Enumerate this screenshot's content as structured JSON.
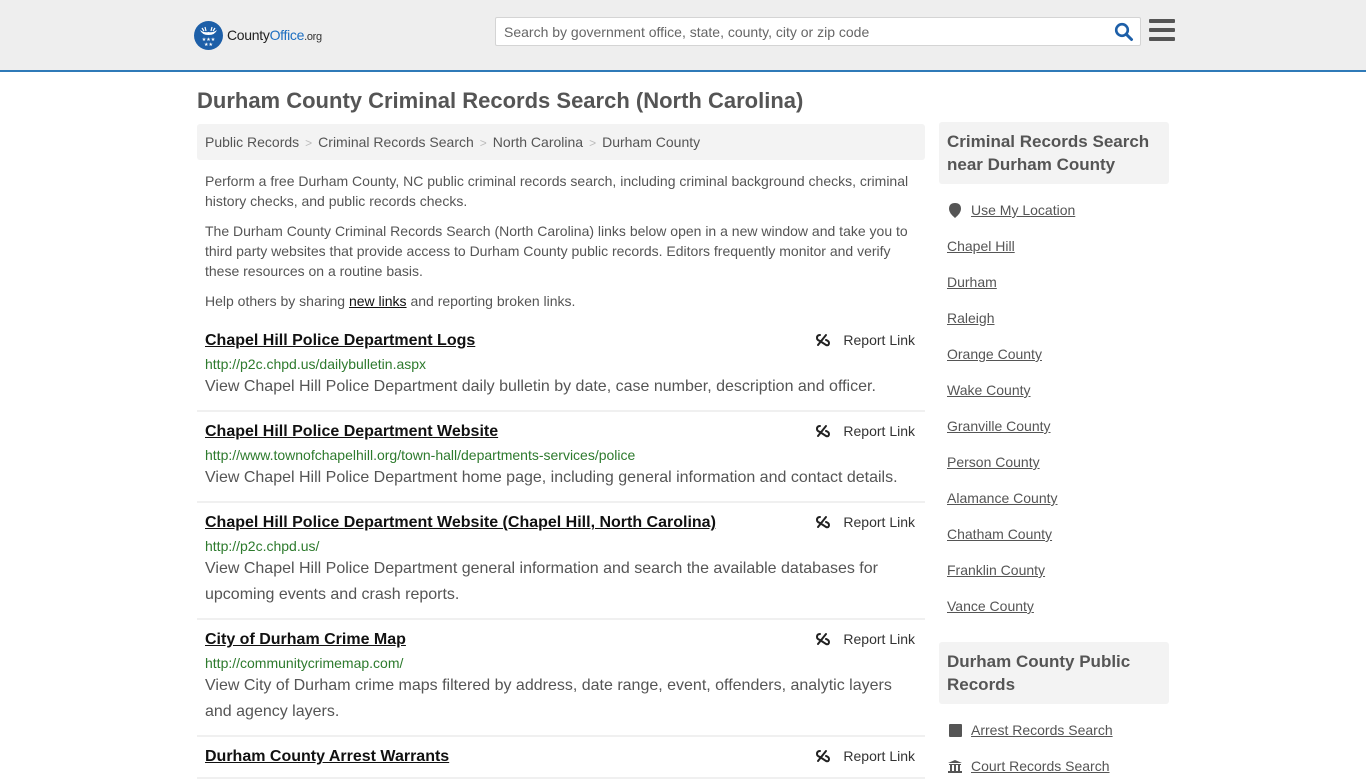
{
  "header": {
    "logo": {
      "name": "County",
      "name_accent": "Office",
      "tld": ".org"
    },
    "search": {
      "placeholder": "Search by government office, state, county, city or zip code",
      "value": ""
    },
    "colors": {
      "accent": "#2f7ab8",
      "logo_blue": "#1d5fa8"
    }
  },
  "page": {
    "title": "Durham County Criminal Records Search (North Carolina)"
  },
  "breadcrumb": [
    {
      "label": "Public Records"
    },
    {
      "label": "Criminal Records Search"
    },
    {
      "label": "North Carolina"
    },
    {
      "label": "Durham County"
    }
  ],
  "intro": {
    "p1": "Perform a free Durham County, NC public criminal records search, including criminal background checks, criminal history checks, and public records checks.",
    "p2": "The Durham County Criminal Records Search (North Carolina) links below open in a new window and take you to third party websites that provide access to Durham County public records. Editors frequently monitor and verify these resources on a routine basis.",
    "p3_before": "Help others by sharing ",
    "p3_link": "new links",
    "p3_after": " and reporting broken links."
  },
  "results": [
    {
      "title": "Chapel Hill Police Department Logs",
      "url": "http://p2c.chpd.us/dailybulletin.aspx",
      "description": "View Chapel Hill Police Department daily bulletin by date, case number, description and officer.",
      "report_label": "Report Link"
    },
    {
      "title": "Chapel Hill Police Department Website",
      "url": "http://www.townofchapelhill.org/town-hall/departments-services/police",
      "description": "View Chapel Hill Police Department home page, including general information and contact details.",
      "report_label": "Report Link"
    },
    {
      "title": "Chapel Hill Police Department Website (Chapel Hill, North Carolina)",
      "url": "http://p2c.chpd.us/",
      "description": "View Chapel Hill Police Department general information and search the available databases for upcoming events and crash reports.",
      "report_label": "Report Link"
    },
    {
      "title": "City of Durham Crime Map",
      "url": "http://communitycrimemap.com/",
      "description": "View City of Durham crime maps filtered by address, date range, event, offenders, analytic layers and agency layers.",
      "report_label": "Report Link"
    },
    {
      "title": "Durham County Arrest Warrants",
      "url": "",
      "description": "",
      "report_label": "Report Link"
    }
  ],
  "sidebar": {
    "nearby": {
      "heading": "Criminal Records Search near Durham County",
      "use_location": "Use My Location",
      "items": [
        "Chapel Hill",
        "Durham",
        "Raleigh",
        "Orange County",
        "Wake County",
        "Granville County",
        "Person County",
        "Alamance County",
        "Chatham County",
        "Franklin County",
        "Vance County"
      ]
    },
    "public_records": {
      "heading": "Durham County Public Records",
      "items": [
        {
          "label": "Arrest Records Search",
          "icon": "square-icon"
        },
        {
          "label": "Court Records Search",
          "icon": "courthouse-icon"
        }
      ]
    }
  }
}
